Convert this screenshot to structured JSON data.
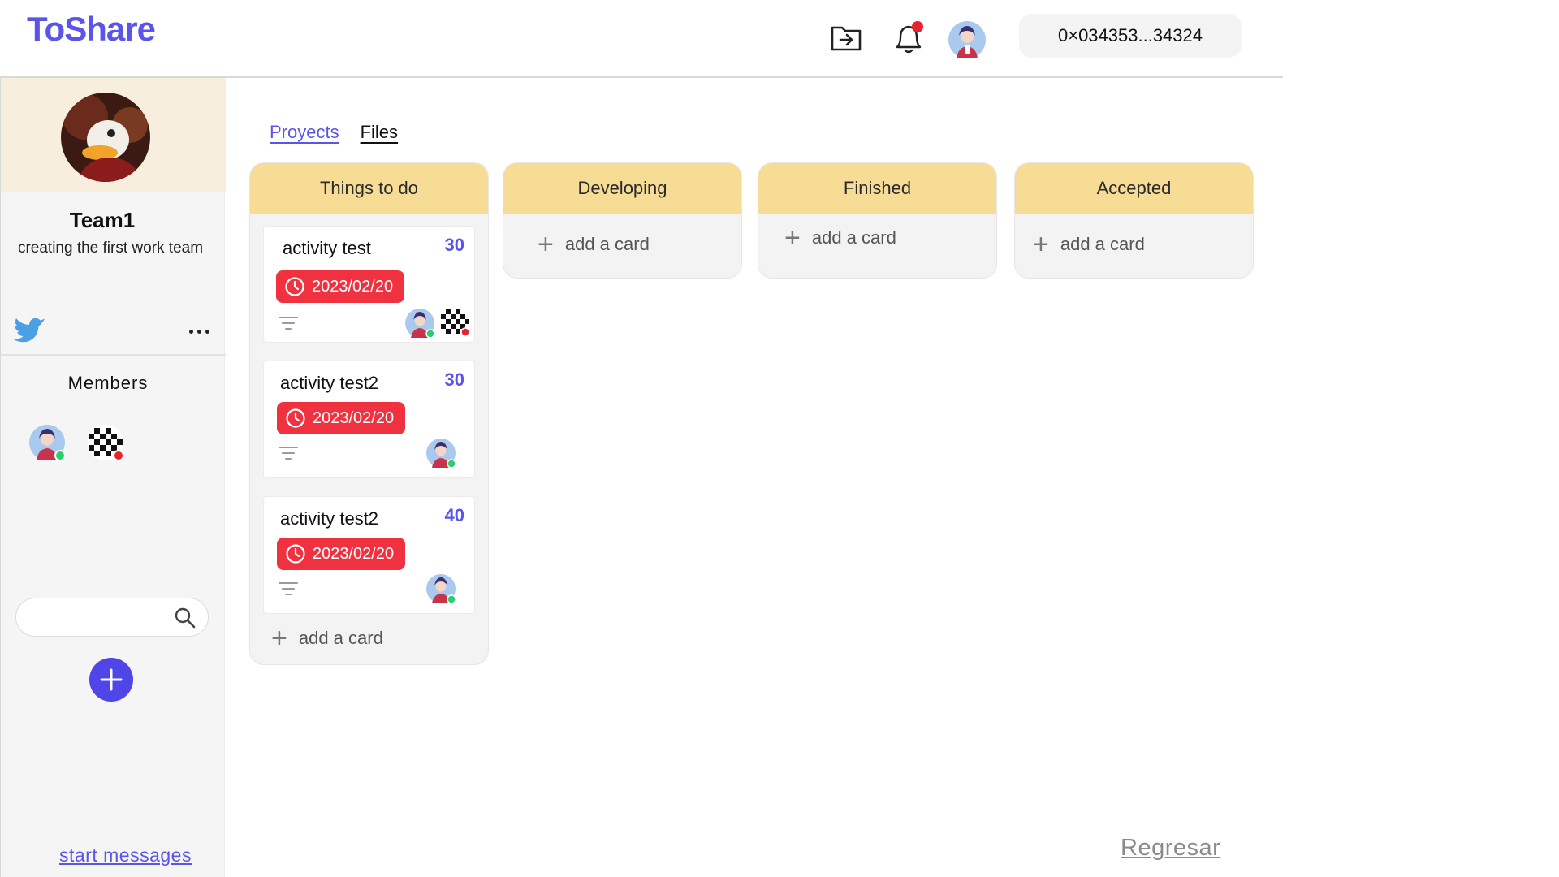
{
  "app": {
    "logo": "ToShare"
  },
  "header": {
    "wallet": "0×034353...34324",
    "icons": [
      "import-icon",
      "bell-icon",
      "avatar"
    ],
    "notification_dot_color": "#e8252e"
  },
  "sidebar": {
    "team_name": "Team1",
    "team_description": "creating the first work team",
    "members_title": "Members",
    "search_placeholder": "",
    "start_messages": "start messages"
  },
  "tabs": [
    {
      "label": "Proyects",
      "active": true
    },
    {
      "label": "Files",
      "active": false
    }
  ],
  "board": {
    "add_card_label": "add a card",
    "columns": [
      {
        "title": "Things to do",
        "cards": [
          {
            "title": "activity test",
            "points": "30",
            "due": "2023/02/20"
          },
          {
            "title": "activity test2",
            "points": "30",
            "due": "2023/02/20"
          },
          {
            "title": "activity test2",
            "points": "40",
            "due": "2023/02/20"
          }
        ]
      },
      {
        "title": "Developing",
        "cards": []
      },
      {
        "title": "Finished",
        "cards": []
      },
      {
        "title": "Accepted",
        "cards": []
      }
    ]
  },
  "footer": {
    "back_link": "Regresar"
  },
  "colors": {
    "accent": "#5b54e8",
    "column_header": "#f7dc95",
    "due_badge": "#f0313f",
    "online": "#2ecc71",
    "offline": "#e8252e"
  }
}
